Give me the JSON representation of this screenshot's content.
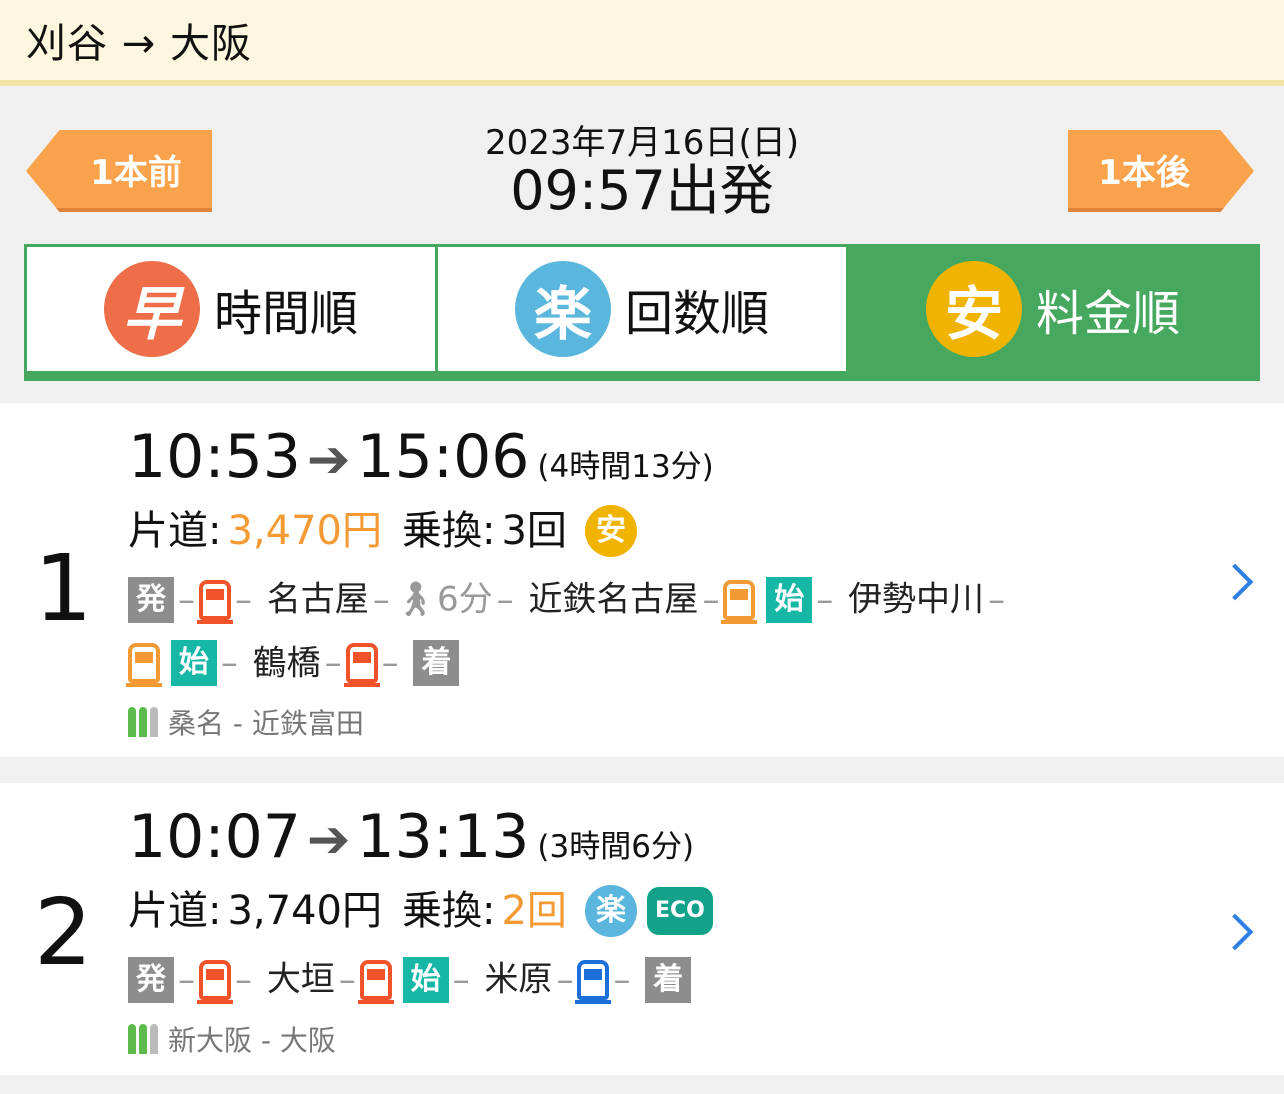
{
  "route": {
    "text": "刈谷 → 大阪"
  },
  "search": {
    "prev_label": "1本前",
    "next_label": "1本後",
    "date": "2023年7月16日(日)",
    "departure": "09:57出発"
  },
  "sort_tabs": [
    {
      "badge": "早",
      "label": "時間順",
      "active": false
    },
    {
      "badge": "楽",
      "label": "回数順",
      "active": false
    },
    {
      "badge": "安",
      "label": "料金順",
      "active": true
    }
  ],
  "results": [
    {
      "rank": "1",
      "depart": "10:53",
      "arrive": "15:06",
      "duration": "(4時間13分)",
      "fare_label": "片道:",
      "fare": "3,470円",
      "transfer_label": "乗換:",
      "transfers": "3回",
      "badge": "安",
      "start": "発",
      "end": "着",
      "origin_flag": "始",
      "stations": [
        "名古屋",
        "近鉄名古屋",
        "伊勢中川",
        "鶴橋"
      ],
      "walk": "6分",
      "seat": "桑名 - 近鉄富田"
    },
    {
      "rank": "2",
      "depart": "10:07",
      "arrive": "13:13",
      "duration": "(3時間6分)",
      "fare_label": "片道:",
      "fare": "3,740円",
      "transfer_label": "乗換:",
      "transfers": "2回",
      "badge": "楽",
      "eco": "ECO",
      "start": "発",
      "end": "着",
      "origin_flag": "始",
      "stations": [
        "大垣",
        "米原"
      ],
      "seat": "新大阪 - 大阪"
    }
  ],
  "colors": {
    "accent_green": "#46a85f",
    "nav_orange": "#fba24d",
    "highlight_orange": "#f39a34",
    "link_blue": "#2d7fe6"
  }
}
